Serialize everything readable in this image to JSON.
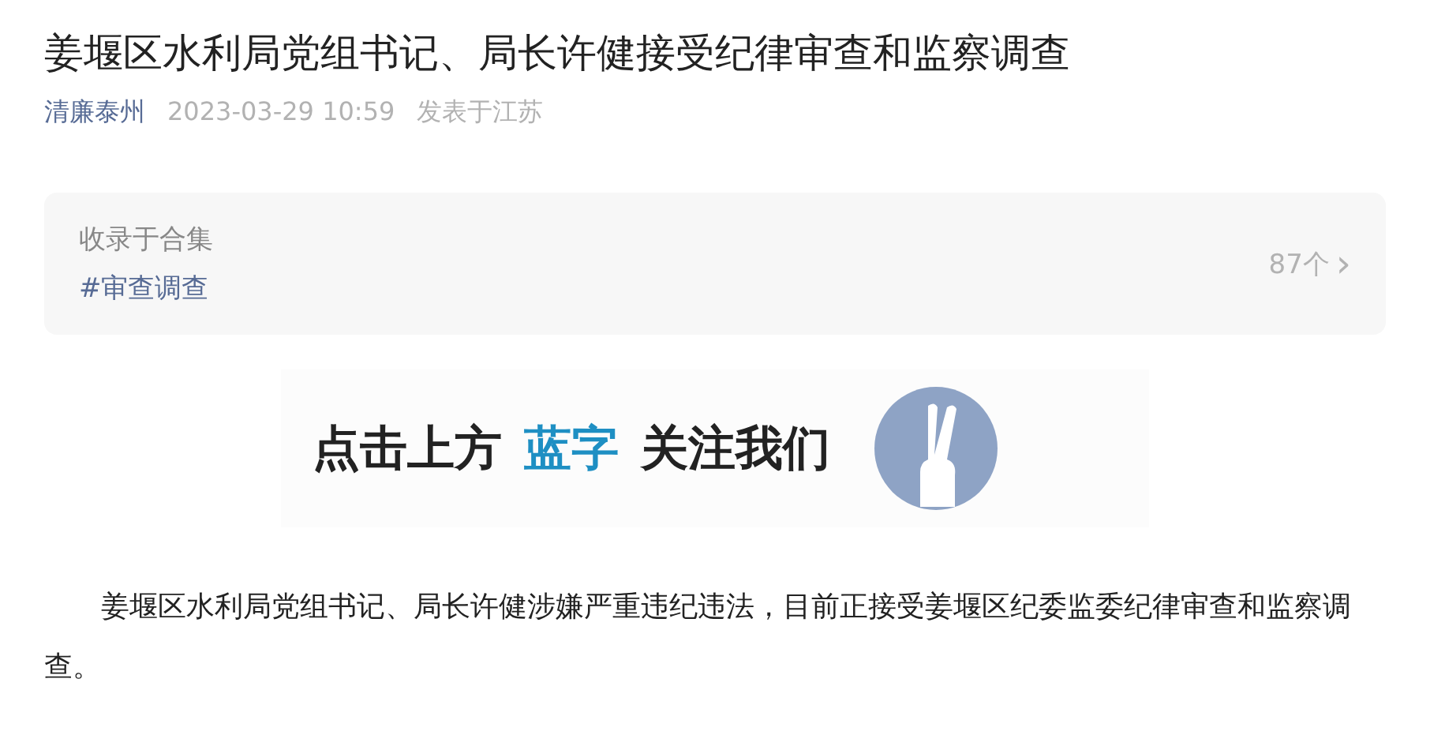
{
  "title": "姜堰区水利局党组书记、局长许健接受纪律审查和监察调查",
  "meta": {
    "account": "清廉泰州",
    "datetime": "2023-03-29 10:59",
    "location": "发表于江苏"
  },
  "collection": {
    "label": "收录于合集",
    "tag": "#审查调查",
    "count": "87个",
    "chevron": "›"
  },
  "banner": {
    "parts": [
      {
        "text": "点击上方",
        "kind": "plain"
      },
      {
        "text": "蓝字",
        "kind": "accent"
      },
      {
        "text": "关注我们",
        "kind": "plain"
      }
    ]
  },
  "paragraph": "姜堰区水利局党组书记、局长许健涉嫌严重违纪违法，目前正接受姜堰区纪委监委纪律审查和监察调查。"
}
